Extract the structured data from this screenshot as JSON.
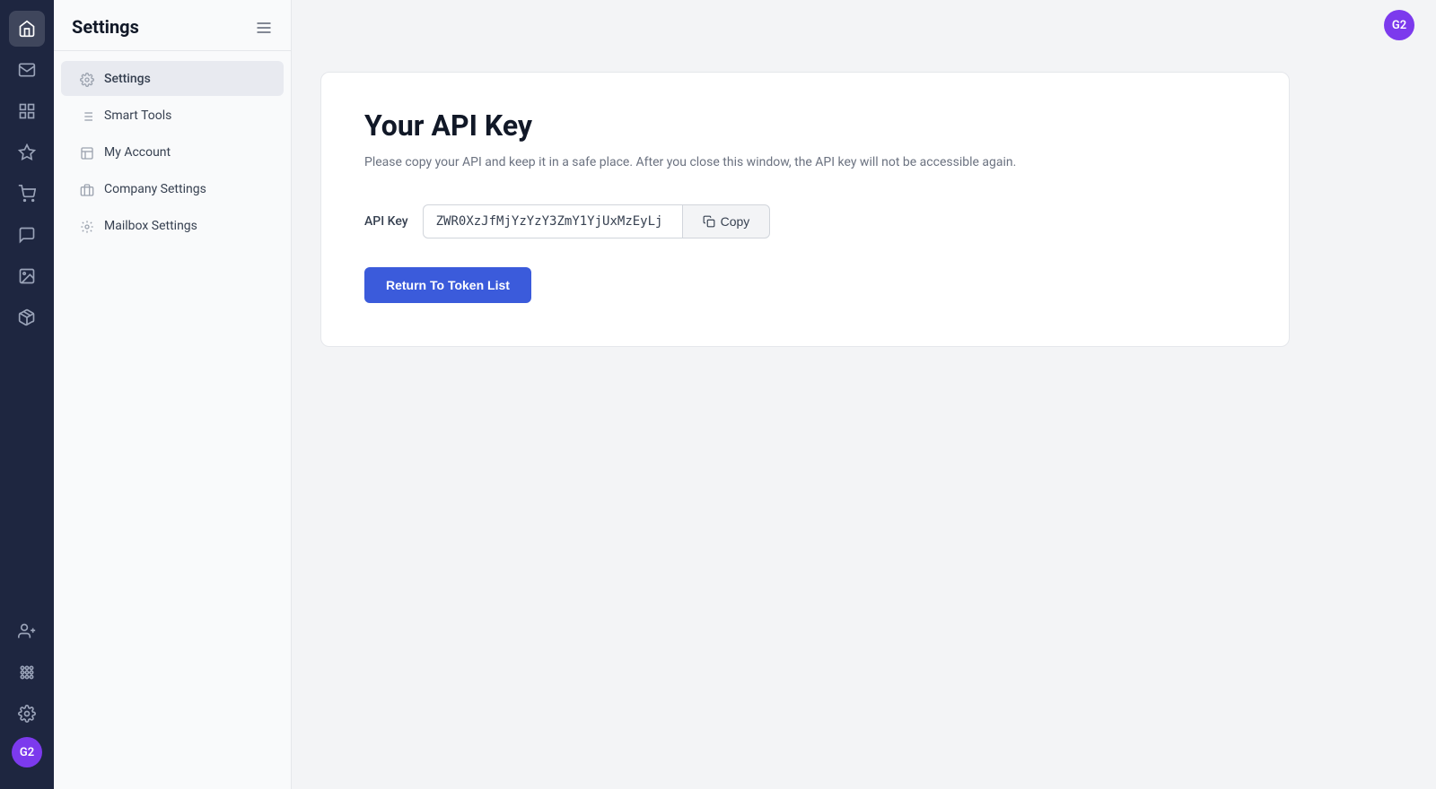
{
  "app": {
    "user_initials": "G2",
    "user_avatar_color": "#7c3aed"
  },
  "sidebar": {
    "title": "Settings",
    "toggle_icon": "menu-icon",
    "items": [
      {
        "id": "settings",
        "label": "Settings",
        "icon": "settings-icon",
        "active": true
      },
      {
        "id": "smart-tools",
        "label": "Smart Tools",
        "icon": "smart-tools-icon",
        "active": false
      },
      {
        "id": "my-account",
        "label": "My Account",
        "icon": "account-icon",
        "active": false
      },
      {
        "id": "company-settings",
        "label": "Company Settings",
        "icon": "company-icon",
        "active": false
      },
      {
        "id": "mailbox-settings",
        "label": "Mailbox Settings",
        "icon": "mailbox-icon",
        "active": false
      }
    ]
  },
  "rail": {
    "icons": [
      {
        "id": "home",
        "symbol": "⌂"
      },
      {
        "id": "mail",
        "symbol": "✉"
      },
      {
        "id": "grid",
        "symbol": "▦"
      },
      {
        "id": "star",
        "symbol": "★"
      },
      {
        "id": "cart",
        "symbol": "🛒"
      },
      {
        "id": "chat",
        "symbol": "💬"
      },
      {
        "id": "image",
        "symbol": "🖼"
      },
      {
        "id": "box",
        "symbol": "📦"
      }
    ],
    "bottom_icons": [
      {
        "id": "add-user",
        "symbol": "👤"
      },
      {
        "id": "apps",
        "symbol": "⊞"
      },
      {
        "id": "gear",
        "symbol": "⚙"
      }
    ]
  },
  "main": {
    "page_title": "Your API Key",
    "description": "Please copy your API and keep it in a safe place. After you close this window, the API key will not be accessible again.",
    "api_key_label": "API Key",
    "api_key_value": "ZWR0XzJfMjYzYzY3ZmY1YjUxMzEyLj",
    "copy_button_label": "Copy",
    "return_button_label": "Return To Token List"
  }
}
